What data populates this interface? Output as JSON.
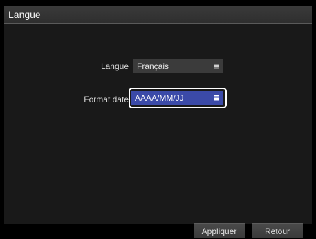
{
  "window": {
    "title": "Langue"
  },
  "settings": {
    "language": {
      "label": "Langue",
      "value": "Français"
    },
    "date_format": {
      "label": "Format date",
      "value": "AAAA/MM/JJ"
    }
  },
  "buttons": {
    "apply": "Appliquer",
    "back": "Retour"
  },
  "colors": {
    "selected_field": "#3b4aa8",
    "focus_ring": "#ffffff"
  }
}
